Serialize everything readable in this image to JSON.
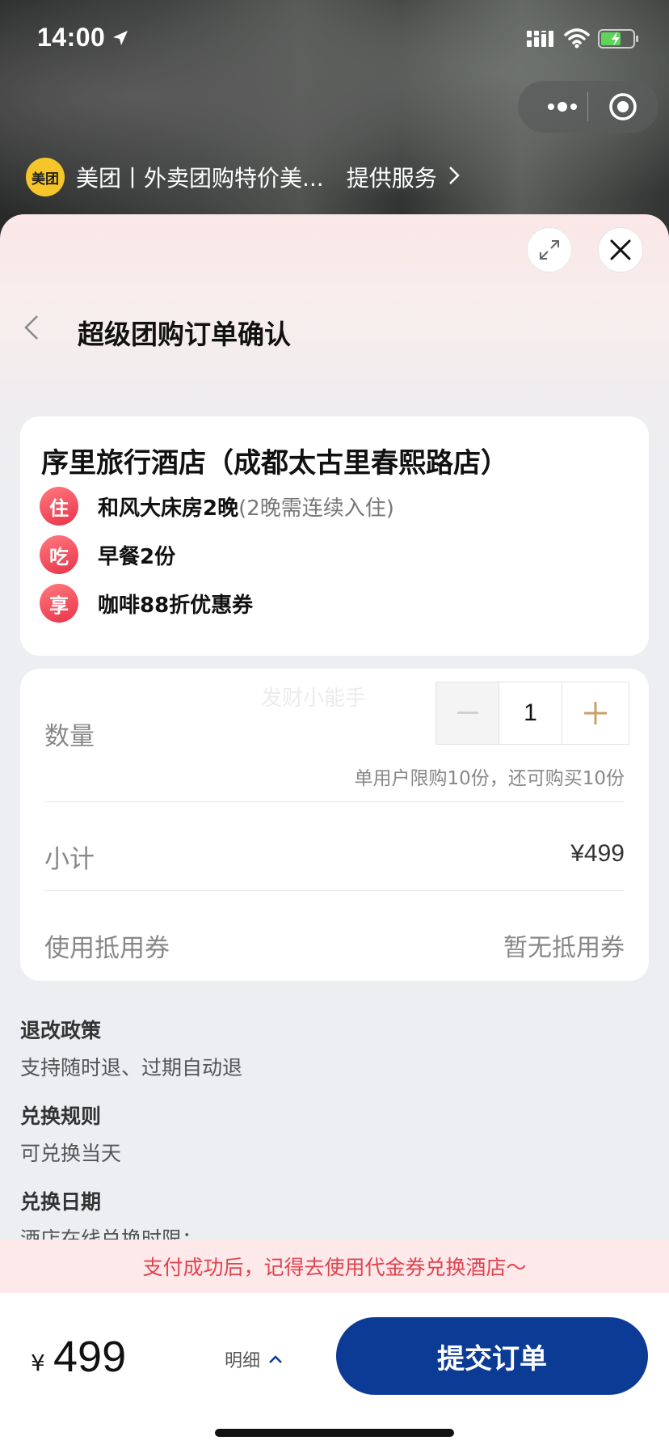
{
  "status_bar": {
    "time": "14:00"
  },
  "provider": {
    "logo_text": "美团",
    "name": "美团丨外卖团购特价美...",
    "suffix": "提供服务"
  },
  "header": {
    "title": "超级团购订单确认"
  },
  "hotel": {
    "name": "序里旅行酒店（成都太古里春熙路店）",
    "benefits": [
      {
        "badge": "住",
        "text": "和风大床房2晚",
        "note": "(2晚需连续入住)"
      },
      {
        "badge": "吃",
        "text": "早餐2份",
        "note": ""
      },
      {
        "badge": "享",
        "text": "咖啡88折优惠券",
        "note": ""
      }
    ]
  },
  "order": {
    "watermark": "发财小能手",
    "quantity_label": "数量",
    "quantity_value": "1",
    "limit_text": "单用户限购10份，还可购买10份",
    "subtotal_label": "小计",
    "subtotal_value": "¥499",
    "voucher_label": "使用抵用券",
    "voucher_value": "暂无抵用券"
  },
  "policies": [
    {
      "title": "退改政策",
      "text": "支持随时退、过期自动退"
    },
    {
      "title": "兑换规则",
      "text": "可兑换当天"
    },
    {
      "title": "兑换日期",
      "text": "酒店在线兑换时限："
    }
  ],
  "notice": "支付成功后，记得去使用代金券兑换酒店～",
  "footer": {
    "price_symbol": "¥",
    "price_value": "499",
    "detail_label": "明细",
    "submit_label": "提交订单"
  },
  "colors": {
    "accent": "#0b3b95",
    "badge": "#e8334a",
    "notice_text": "#e0434f",
    "plus": "#c9a06a"
  }
}
